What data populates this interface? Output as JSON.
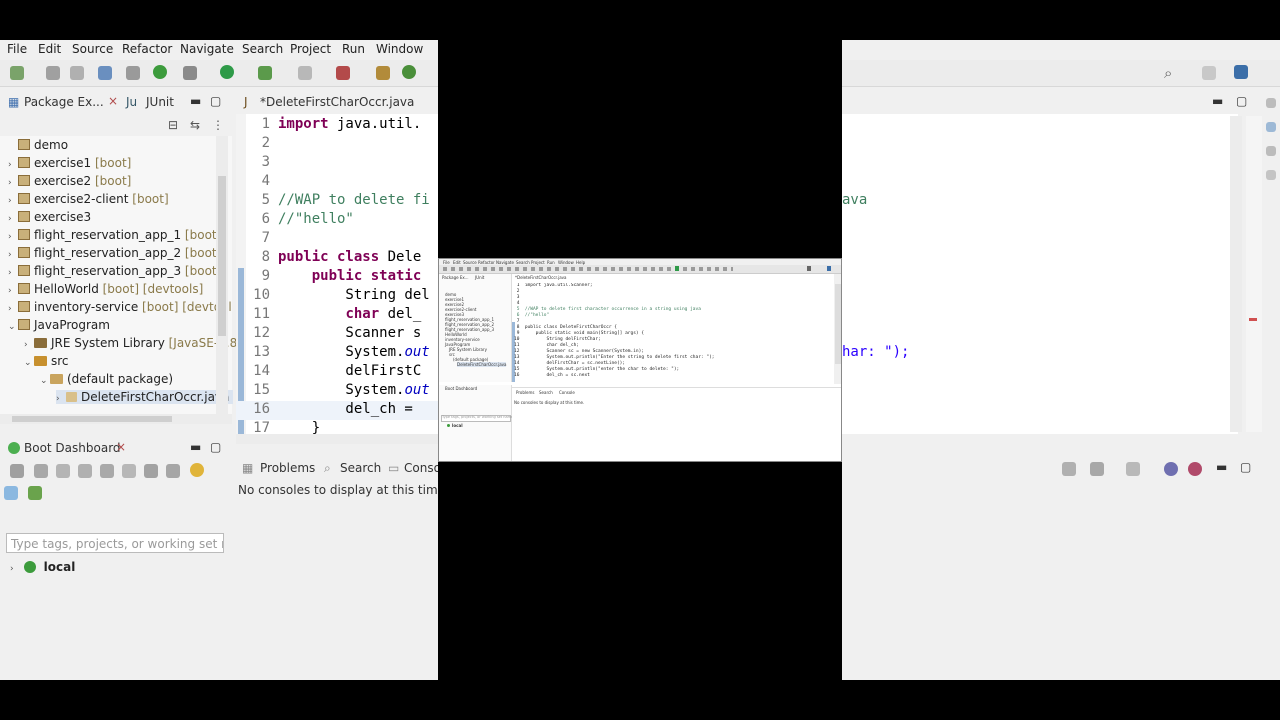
{
  "menu": [
    "File",
    "Edit",
    "Source",
    "Refactor",
    "Navigate",
    "Search",
    "Project",
    "Run",
    "Window"
  ],
  "explorer": {
    "tabs": [
      "Package Ex...",
      "JUnit"
    ],
    "items": [
      {
        "label": "demo",
        "suffix": ""
      },
      {
        "label": "exercise1",
        "suffix": " [boot]"
      },
      {
        "label": "exercise2",
        "suffix": " [boot]"
      },
      {
        "label": "exercise2-client",
        "suffix": " [boot]"
      },
      {
        "label": "exercise3",
        "suffix": ""
      },
      {
        "label": "flight_reservation_app_1",
        "suffix": " [boot]"
      },
      {
        "label": "flight_reservation_app_2",
        "suffix": " [boot]"
      },
      {
        "label": "flight_reservation_app_3",
        "suffix": " [boot]"
      },
      {
        "label": "HelloWorld",
        "suffix": " [boot] [devtools]"
      },
      {
        "label": "inventory-service",
        "suffix": " [boot] [devtool"
      },
      {
        "label": "JavaProgram",
        "suffix": ""
      },
      {
        "label": "JRE System Library",
        "suffix": " [JavaSE-1.8"
      },
      {
        "label": "src",
        "suffix": ""
      },
      {
        "label": "(default package)",
        "suffix": ""
      },
      {
        "label": "DeleteFirstCharOccr.java",
        "suffix": ""
      }
    ]
  },
  "boot_dashboard": {
    "title": "Boot Dashboard",
    "filter_placeholder": "Type tags, projects, or working set name",
    "local_label": "local"
  },
  "editor": {
    "tab_label": "*DeleteFirstCharOccr.java",
    "lines": [
      {
        "n": "1",
        "html": "<span class='kw'>import</span> java.util."
      },
      {
        "n": "2",
        "html": ""
      },
      {
        "n": "3",
        "html": ""
      },
      {
        "n": "4",
        "html": ""
      },
      {
        "n": "5",
        "html": "<span class='cm'>//WAP to delete fi</span>"
      },
      {
        "n": "6",
        "html": "<span class='cm'>//\"hello\"</span>"
      },
      {
        "n": "7",
        "html": ""
      },
      {
        "n": "8",
        "html": "<span class='kw'>public class</span> Dele"
      },
      {
        "n": "9",
        "html": "    <span class='kw'>public static</span>"
      },
      {
        "n": "10",
        "html": "        String del"
      },
      {
        "n": "11",
        "html": "        <span class='kw'>char</span> del_"
      },
      {
        "n": "12",
        "html": "        Scanner s"
      },
      {
        "n": "13",
        "html": "        System.<span class='fld'>out</span>"
      },
      {
        "n": "14",
        "html": "        delFirstC"
      },
      {
        "n": "15",
        "html": "        System.<span class='fld'>out</span>"
      },
      {
        "n": "16",
        "html": "        del_ch = "
      },
      {
        "n": "17",
        "html": "    }"
      }
    ]
  },
  "bottom": {
    "tabs": [
      "Problems",
      "Search",
      "Conso"
    ],
    "message": "No consoles to display at this time."
  },
  "right": {
    "code_fragment_1": "ava",
    "code_fragment_2": "har: \");"
  },
  "center": {
    "menu": [
      "File",
      "Edit",
      "Source",
      "Refactor",
      "Navigate",
      "Search",
      "Project",
      "Run",
      "Window",
      "Help"
    ],
    "editor_tab": "*DeleteFirstCharOccr.java",
    "code": [
      "import java.util.Scanner;",
      "",
      "",
      "",
      "//WAP to delete first character occurrence in a string using java",
      "//\"hello\"",
      "",
      "public class DeleteFirstCharOccr {",
      "    public static void main(String[] args) {",
      "        String delFirstChar;",
      "        char del_ch;",
      "        Scanner sc = new Scanner(System.in);",
      "        System.out.println(\"Enter the string to delete first char: \");",
      "        delFirstChar = sc.nextLine();",
      "        System.out.println(\"enter the char to delete: \");",
      "        del_ch = sc.next"
    ],
    "bottom_tabs": [
      "Problems",
      "Search",
      "Console"
    ],
    "console_msg": "No consoles to display at this time.",
    "boot_title": "Boot Dashboard",
    "filter_placeholder": "Type tags, projects, or working set name",
    "local_label": "local"
  }
}
